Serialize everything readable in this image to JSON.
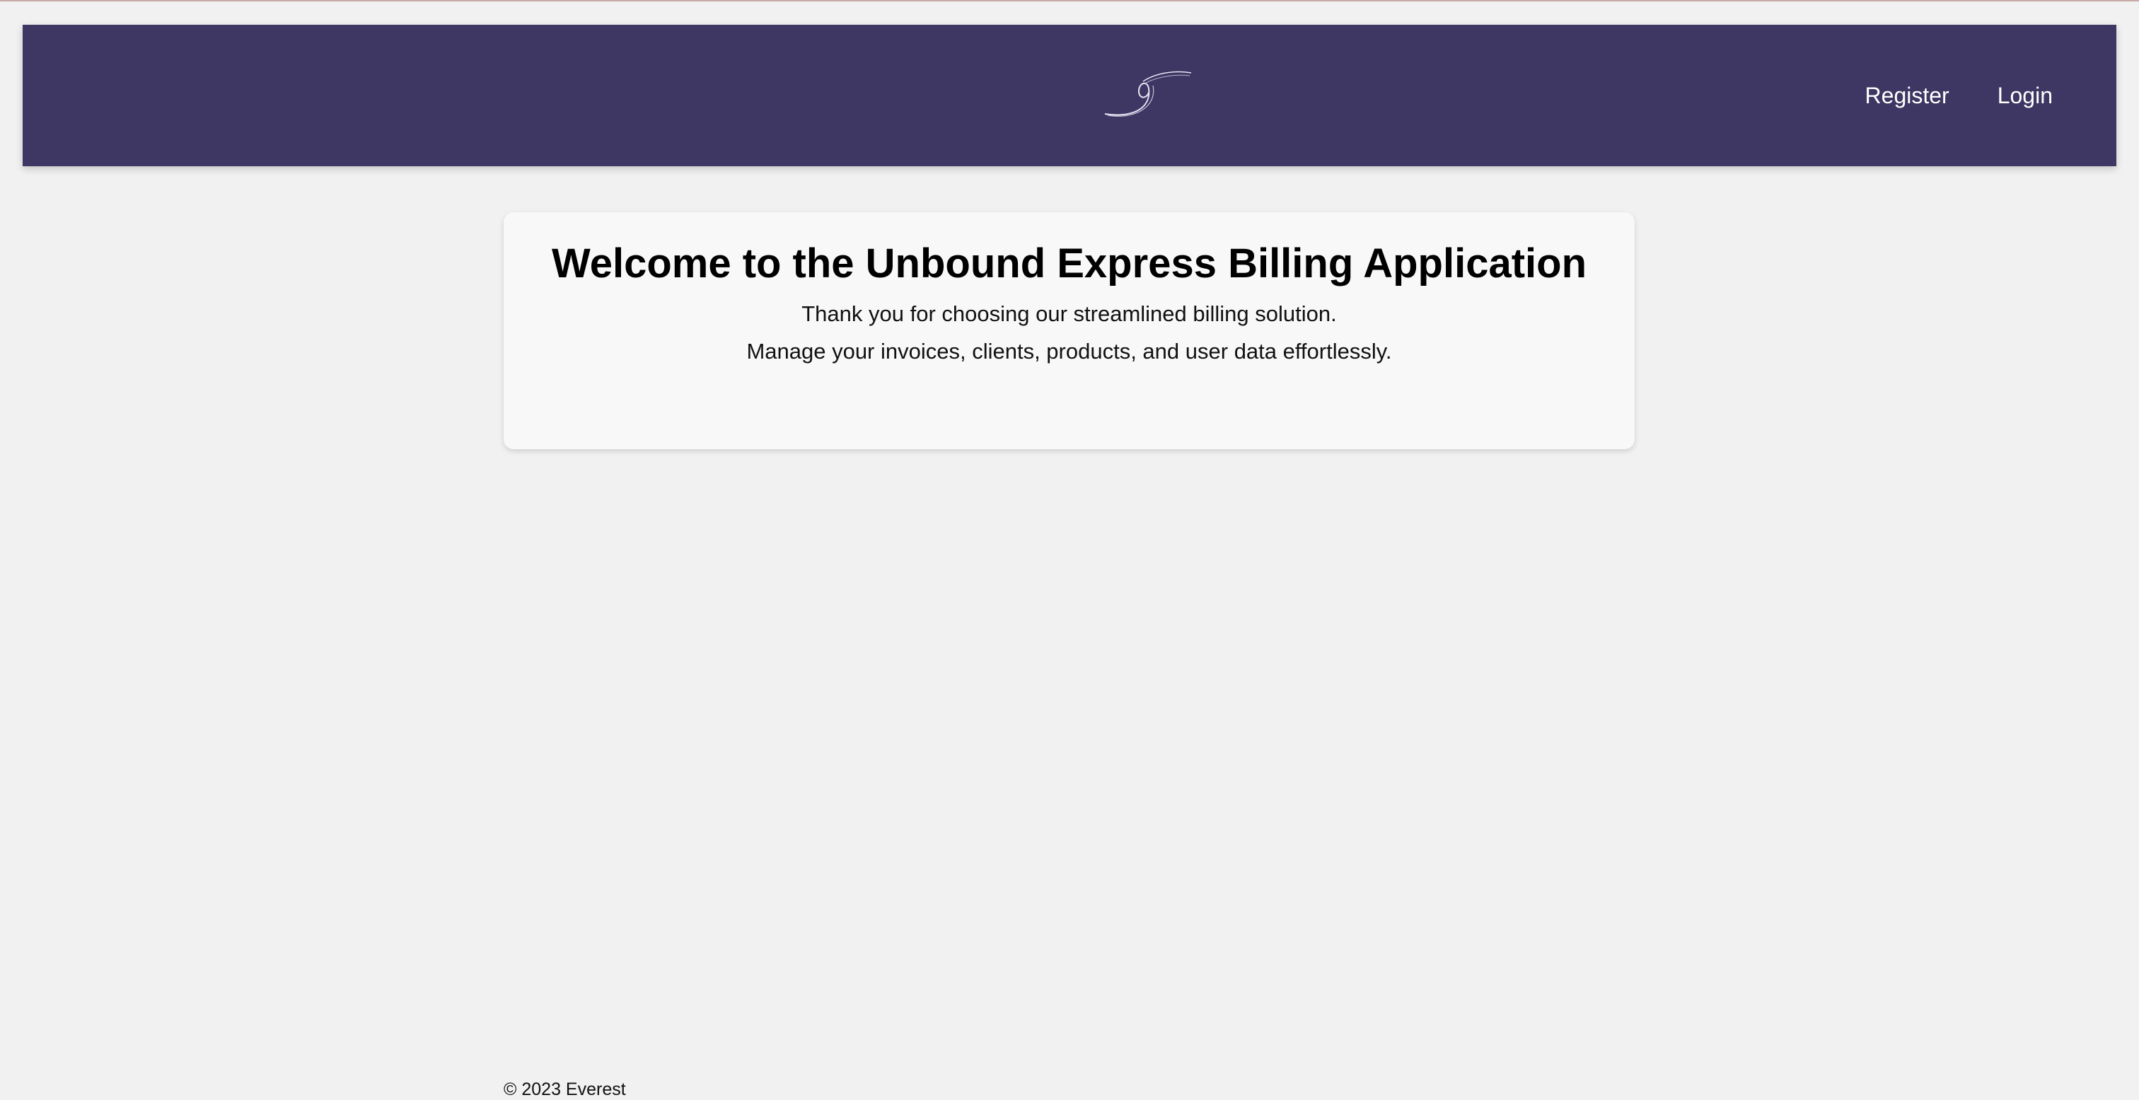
{
  "header": {
    "background_color": "#3e3763",
    "logo_icon": "swirl-logo-icon",
    "nav": {
      "register_label": "Register",
      "login_label": "Login"
    }
  },
  "welcome": {
    "title": "Welcome to the Unbound Express Billing Application",
    "line1": "Thank you for choosing our streamlined billing solution.",
    "line2": "Manage your invoices, clients, products, and user data effortlessly."
  },
  "footer": {
    "text": "© 2023 Everest"
  }
}
